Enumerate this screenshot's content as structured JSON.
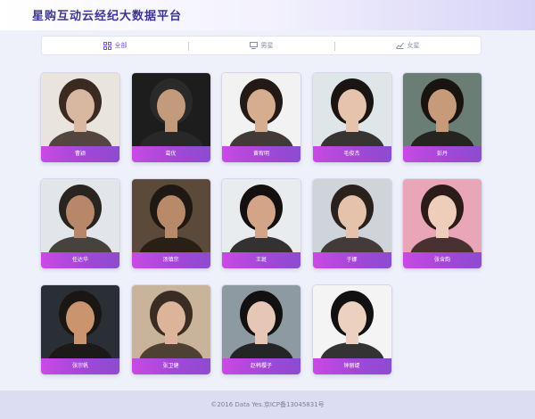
{
  "header": {
    "title": "星购互动云经纪大数据平台"
  },
  "tabs": [
    {
      "label": "全部",
      "icon": "grid-icon",
      "active": true
    },
    {
      "label": "男星",
      "icon": "monitor-icon",
      "active": false
    },
    {
      "label": "女星",
      "icon": "chart-icon",
      "active": false
    }
  ],
  "artists": [
    {
      "name": "曹颖"
    },
    {
      "name": "葛优"
    },
    {
      "name": "黄宥明"
    },
    {
      "name": "毛俊杰"
    },
    {
      "name": "彭丹"
    },
    {
      "name": "任达华"
    },
    {
      "name": "汤镇宗"
    },
    {
      "name": "王斑"
    },
    {
      "name": "于娜"
    },
    {
      "name": "张含韵"
    },
    {
      "name": "张宗帆"
    },
    {
      "name": "张卫健"
    },
    {
      "name": "赵韩樱子"
    },
    {
      "name": "钟丽缇"
    }
  ],
  "footer": {
    "text": "©2016 Data Yes.京ICP备13045831号"
  },
  "colors": {
    "accent": "#7b54d6",
    "title": "#3b3399",
    "name_bar_start": "#c94ae3",
    "name_bar_end": "#8c4ccf"
  }
}
